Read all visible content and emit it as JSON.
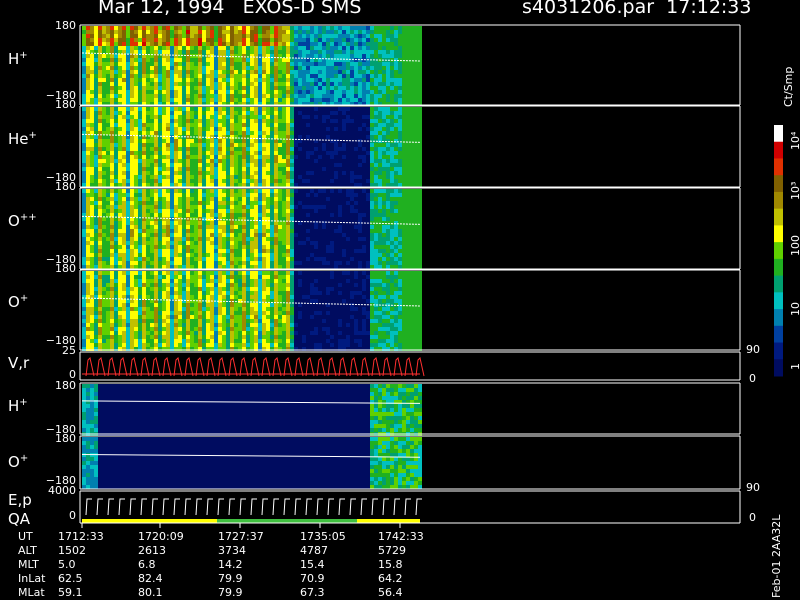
{
  "header": {
    "date_instrument": "Mar 12, 1994   EXOS-D SMS",
    "file_time": "s4031206.par  17:12:33"
  },
  "colorbar": {
    "unit": "Ct/Smp",
    "labels": [
      "10⁴",
      "10³",
      "100",
      "10",
      "1"
    ],
    "colors": [
      "#ffffff",
      "#d00000",
      "#e03000",
      "#806000",
      "#a08800",
      "#c0c000",
      "#ffff00",
      "#60d000",
      "#20b020",
      "#00a070",
      "#00c0c0",
      "#0080b0",
      "#0040a0",
      "#001a80",
      "#000c60"
    ]
  },
  "panels": [
    {
      "label": "H",
      "sup": "+",
      "ymax": "180",
      "ymin": "−180"
    },
    {
      "label": "He",
      "sup": "+",
      "ymax": "180",
      "ymin": "−180"
    },
    {
      "label": "O",
      "sup": "++",
      "ymax": "180",
      "ymin": "−180"
    },
    {
      "label": "O",
      "sup": "+",
      "ymax": "180",
      "ymin": "−180"
    },
    {
      "label": "V,r",
      "sup": "",
      "ymax": "25",
      "ymin": "0",
      "right_max": "90",
      "right_min": "0"
    },
    {
      "label": "H",
      "sup": "+",
      "ymax": "180",
      "ymin": "−180"
    },
    {
      "label": "O",
      "sup": "+",
      "ymax": "180",
      "ymin": "−180"
    },
    {
      "label": "E,p",
      "label2": "QA",
      "ymax": "4000",
      "ymin": "0",
      "right_max": "90",
      "right_min": "0"
    }
  ],
  "ephemeris": {
    "rows": [
      "UT",
      "ALT",
      "MLT",
      "InLat",
      "MLat"
    ],
    "columns": [
      [
        "1712:33",
        "1502",
        "5.0",
        "62.5",
        "59.1"
      ],
      [
        "1720:09",
        "2613",
        "6.8",
        "82.4",
        "80.1"
      ],
      [
        "1727:37",
        "3734",
        "14.2",
        "79.9",
        "79.9"
      ],
      [
        "1735:05",
        "4787",
        "15.4",
        "70.9",
        "67.3"
      ],
      [
        "1742:33",
        "5729",
        "15.8",
        "64.2",
        "56.4"
      ]
    ]
  },
  "footer_id": "Feb-01 2AA32L",
  "chart_data": {
    "type": "heatmap",
    "title": "Mar 12, 1994   EXOS-D SMS",
    "x": [
      "1712:33",
      "1720:09",
      "1727:37",
      "1735:05",
      "1742:33"
    ],
    "xlabel": "UT",
    "ylabel": "",
    "ylim": [
      -180,
      180
    ],
    "series": [
      {
        "name": "H+"
      },
      {
        "name": "He+"
      },
      {
        "name": "O++"
      },
      {
        "name": "O+"
      },
      {
        "name": "V,r"
      },
      {
        "name": "H+"
      },
      {
        "name": "O+"
      },
      {
        "name": "E,p"
      }
    ],
    "colorbar_range": [
      1,
      10000
    ],
    "colorbar_scale": "log"
  }
}
